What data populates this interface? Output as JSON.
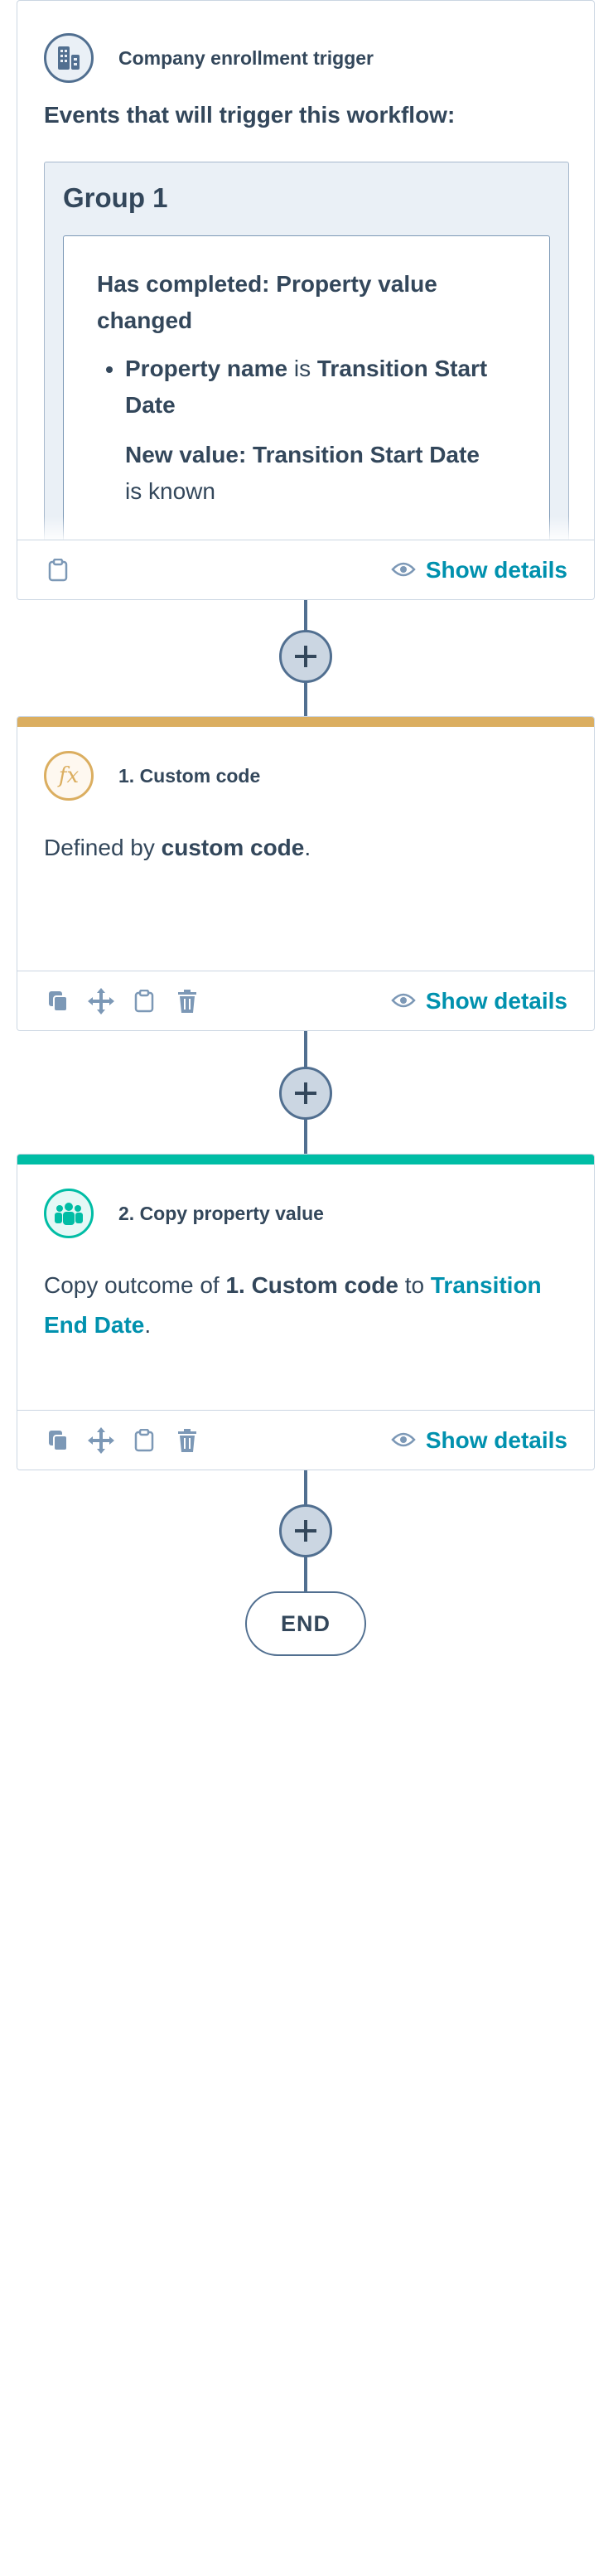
{
  "trigger": {
    "title": "Company enrollment trigger",
    "events_heading": "Events that will trigger this workflow:",
    "group_label": "Group 1",
    "filter_title": "Has completed: Property value changed",
    "filter_items": [
      {
        "property_label": "Property name",
        "operator": "is",
        "property_value": "Transition Start Date"
      }
    ],
    "new_value_label": "New value: Transition Start Date",
    "new_value_condition": "is known",
    "show_details": "Show details"
  },
  "actions": [
    {
      "title": "1. Custom code",
      "accent_color": "#dbae60",
      "text_prefix": "Defined by",
      "text_bold": "custom code",
      "text_suffix": ".",
      "show_details": "Show details"
    },
    {
      "title": "2. Copy property value",
      "accent_color": "#00bda5",
      "text_prefix": "Copy outcome of",
      "text_bold": "1. Custom code",
      "text_middle": "to",
      "text_link": "Transition End Date",
      "text_suffix": ".",
      "show_details": "Show details"
    }
  ],
  "end_label": "END",
  "colors": {
    "link": "#0091ae",
    "text": "#33475b",
    "border": "#cbd6e2",
    "connector": "#516f90"
  },
  "icons": {
    "trigger": "building-icon",
    "custom_code": "function-icon",
    "copy_property": "contacts-icon",
    "clone": "clone-icon",
    "move": "move-icon",
    "clipboard": "clipboard-icon",
    "delete": "trash-icon",
    "show_details": "eye-icon",
    "add": "plus-icon"
  }
}
